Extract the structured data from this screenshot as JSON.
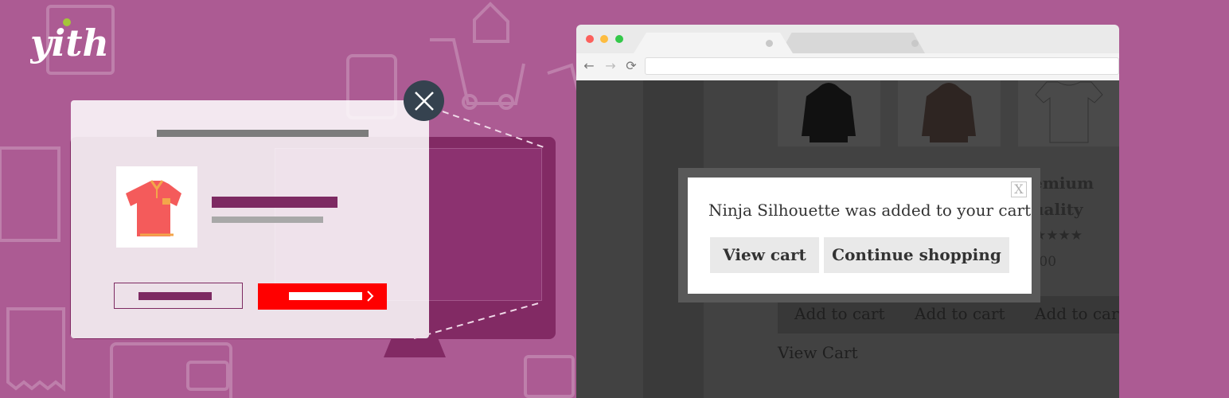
{
  "logo": {
    "text": "yith",
    "accent_color": "#a4c639"
  },
  "colors": {
    "background": "#ac5b93",
    "mock_monitor": "#822a64",
    "mock_accent": "#7d2a62",
    "mock_cta": "#ff0000",
    "close_button": "#35424f"
  },
  "mock_popup": {
    "close_icon": "close-x-icon",
    "product_icon": "polo-shirt-icon",
    "cta_icon": "chevron-right-icon"
  },
  "browser": {
    "nav": {
      "back": "←",
      "forward": "→",
      "reload": "⟳"
    },
    "products": {
      "partial_title_line1": "emium",
      "partial_title_line2": "uality",
      "partial_rating": "★★★★",
      "partial_price": ".00"
    },
    "add_to_cart_buttons": [
      "Add to cart",
      "Add to cart",
      "Add to car"
    ],
    "view_cart_link": "View Cart",
    "popup": {
      "close": "X",
      "message": "Ninja Silhouette was added to your cart",
      "view_cart": "View cart",
      "continue_shopping": "Continue shopping"
    }
  }
}
